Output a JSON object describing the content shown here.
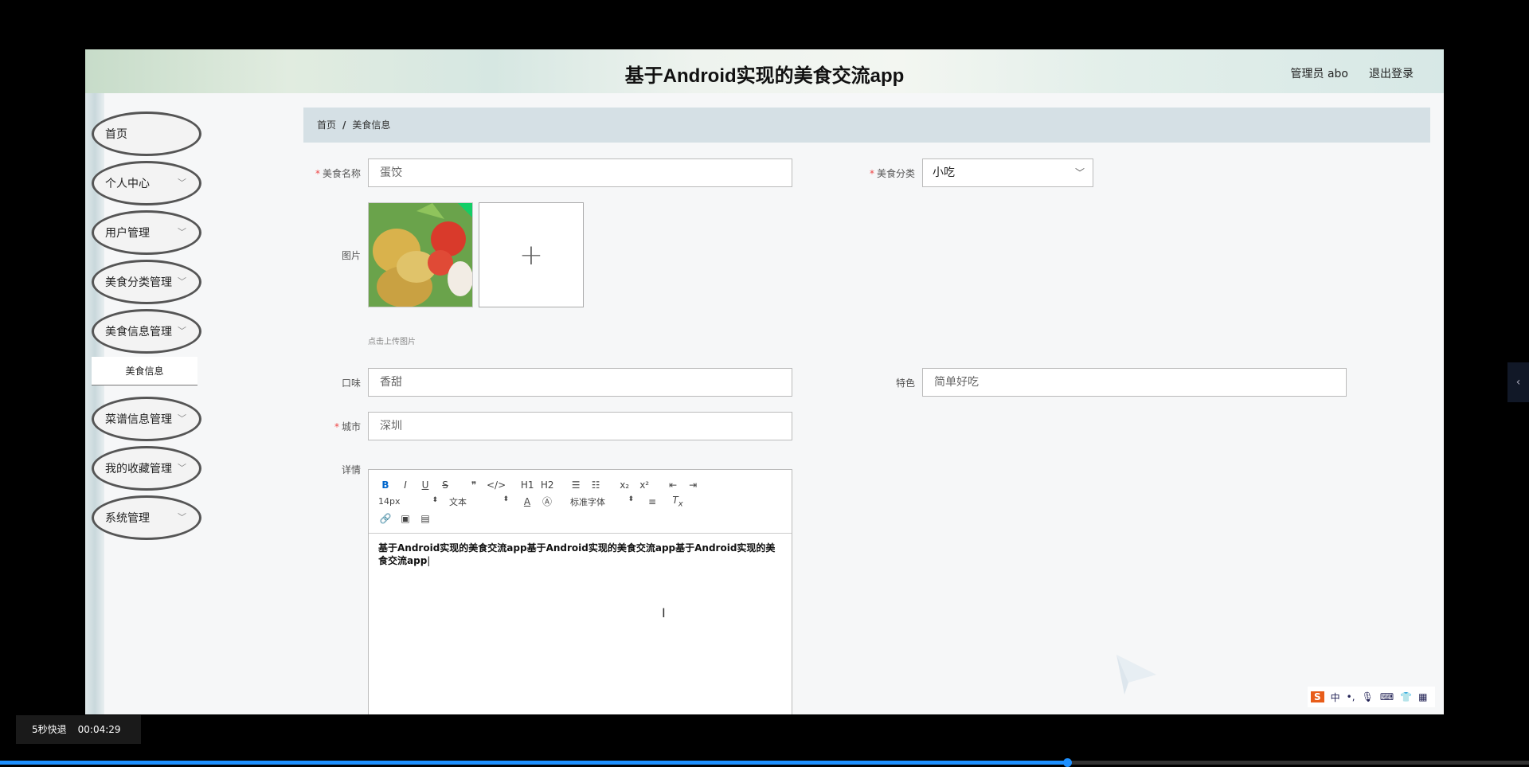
{
  "header": {
    "title": "基于Android实现的美食交流app",
    "user": "管理员 abo",
    "logout": "退出登录"
  },
  "sidebar": {
    "items": [
      {
        "label": "首页",
        "expandable": false
      },
      {
        "label": "个人中心",
        "expandable": true
      },
      {
        "label": "用户管理",
        "expandable": true
      },
      {
        "label": "美食分类管理",
        "expandable": true
      },
      {
        "label": "美食信息管理",
        "expandable": true,
        "subitem": "美食信息"
      },
      {
        "label": "菜谱信息管理",
        "expandable": true
      },
      {
        "label": "我的收藏管理",
        "expandable": true
      },
      {
        "label": "系统管理",
        "expandable": true
      }
    ]
  },
  "breadcrumb": {
    "home": "首页",
    "sep": "/",
    "current": "美食信息"
  },
  "form": {
    "name_label": "美食名称",
    "name_value": "蛋饺",
    "category_label": "美食分类",
    "category_value": "小吃",
    "image_label": "图片",
    "upload_hint": "点击上传图片",
    "taste_label": "口味",
    "taste_value": "香甜",
    "feature_label": "特色",
    "feature_value": "简单好吃",
    "city_label": "城市",
    "city_value": "深圳",
    "detail_label": "详情"
  },
  "editor": {
    "row1": [
      "B",
      "I",
      "U",
      "S",
      "❞",
      "</>",
      "H1",
      "H2",
      "☰",
      "☷",
      "x₂",
      "x²",
      "⇤",
      "⇥"
    ],
    "font_size": "14px",
    "text_type": "文本",
    "font_family": "标准字体",
    "content": "基于Android实现的美食交流app基于Android实现的美食交流app基于Android实现的美食交流app"
  },
  "ime": {
    "lang": "中"
  },
  "player": {
    "skip_label": "5秒快退",
    "time": "00:04:29",
    "progress": 0.698
  }
}
